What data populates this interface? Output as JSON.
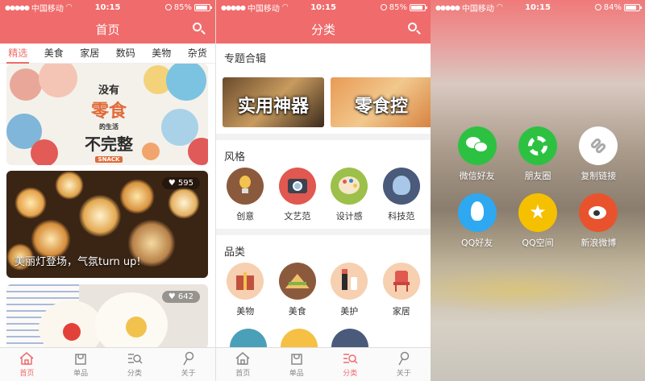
{
  "status": {
    "carrier": "中国移动",
    "time": "10:15",
    "battery_left": "85%",
    "battery_mid": "85%",
    "battery_right": "84%",
    "battery_left_level": 0.85,
    "battery_right_level": 0.84
  },
  "home": {
    "title": "首页",
    "tabs": [
      "精选",
      "美食",
      "家居",
      "数码",
      "美物",
      "杂货"
    ],
    "active_tab": 0,
    "card1": {
      "poster_lines": [
        "没有",
        "零食",
        "的生活",
        "不完整"
      ],
      "tag": "SNACK"
    },
    "card2": {
      "likes": "595",
      "title": "美丽灯登场，气氛turn up!"
    },
    "card3": {
      "likes": "642"
    }
  },
  "category": {
    "title": "分类",
    "topics_title": "专题合辑",
    "topics": [
      "实用神器",
      "零食控"
    ],
    "style_title": "风格",
    "styles": [
      {
        "label": "创意",
        "icon": "lightbulb-icon",
        "color": "#8b5a3c"
      },
      {
        "label": "文艺范",
        "icon": "camera-icon",
        "color": "#e0584f"
      },
      {
        "label": "设计感",
        "icon": "palette-icon",
        "color": "#9cc04a"
      },
      {
        "label": "科技范",
        "icon": "brain-icon",
        "color": "#4a5a7a"
      }
    ],
    "cat_title": "品类",
    "cats": [
      {
        "label": "美物",
        "icon": "gift-icon",
        "color": "#f6d0b0"
      },
      {
        "label": "美食",
        "icon": "sandwich-icon",
        "color": "#8b5a3c"
      },
      {
        "label": "美护",
        "icon": "cosmetics-icon",
        "color": "#f6d0b0"
      },
      {
        "label": "家居",
        "icon": "chair-icon",
        "color": "#f6d0b0"
      }
    ],
    "cats_row2_colors": [
      "#4aa0b8",
      "#f5c043",
      "#4a5a7a"
    ]
  },
  "share": {
    "items": [
      {
        "label": "微信好友",
        "icon": "wechat-icon",
        "color": "#2dc142"
      },
      {
        "label": "朋友圈",
        "icon": "moments-icon",
        "color": "#2dc142"
      },
      {
        "label": "复制链接",
        "icon": "link-icon",
        "color": "#ffffff"
      },
      {
        "label": "QQ好友",
        "icon": "qq-icon",
        "color": "#2ea8f0"
      },
      {
        "label": "QQ空间",
        "icon": "qzone-icon",
        "color": "#f5c000"
      },
      {
        "label": "新浪微博",
        "icon": "weibo-icon",
        "color": "#e8532e"
      }
    ]
  },
  "tabbar": [
    {
      "label": "首页",
      "icon": "home-icon"
    },
    {
      "label": "单品",
      "icon": "bag-icon"
    },
    {
      "label": "分类",
      "icon": "category-search-icon"
    },
    {
      "label": "关于",
      "icon": "about-icon"
    }
  ],
  "colors": {
    "accent": "#f06b6b"
  }
}
